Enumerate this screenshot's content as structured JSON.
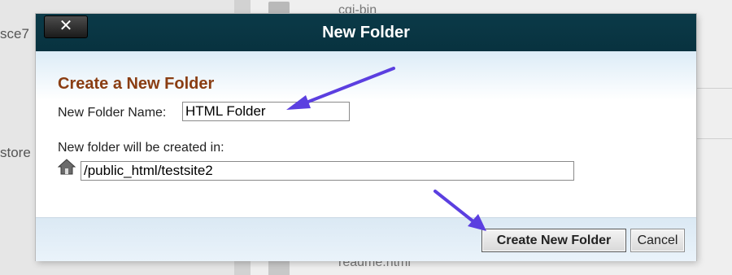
{
  "background": {
    "left_fragments": [
      "sce7",
      "store"
    ],
    "files": [
      "cgi-bin",
      "readme.html"
    ]
  },
  "dialog": {
    "title": "New Folder",
    "close_label": "✕",
    "heading": "Create a New Folder",
    "name_label": "New Folder Name:",
    "name_value": "HTML Folder",
    "path_label": "New folder will be created in:",
    "path_value": "/public_html/testsite2",
    "create_button": "Create New Folder",
    "cancel_button": "Cancel"
  },
  "colors": {
    "titlebar": "#0b3a48",
    "heading": "#8a3d12",
    "annotation_arrow": "#5b3fe0"
  },
  "icons": {
    "close": "close-icon",
    "home": "home-icon"
  }
}
